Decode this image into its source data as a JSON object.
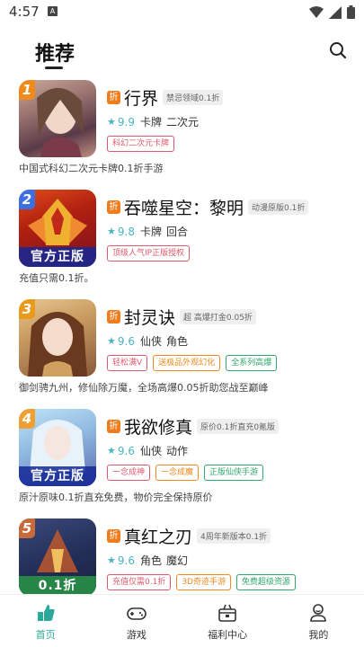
{
  "status": {
    "time": "4:57",
    "notif": "A"
  },
  "header": {
    "title": "推荐"
  },
  "games": [
    {
      "rank": "1",
      "rank_color": "#f08a1d",
      "name": "行界",
      "subtitle": "禁忌领域0.1折",
      "score": "9.9",
      "genres": [
        "卡牌",
        "二次元"
      ],
      "tags": [
        {
          "text": "科幻二次元卡牌",
          "color": "#e05a6d"
        }
      ],
      "desc": "中国式科幻二次元卡牌0.1折手游",
      "banner": ""
    },
    {
      "rank": "2",
      "rank_color": "#3e6fe0",
      "name": "吞噬星空：黎明",
      "subtitle": "动漫原版0.1折",
      "score": "9.8",
      "genres": [
        "卡牌",
        "回合"
      ],
      "tags": [
        {
          "text": "顶级人气IP正版授权",
          "color": "#e05a6d"
        }
      ],
      "desc": "充值只需0.1折。",
      "banner": "官方正版"
    },
    {
      "rank": "3",
      "rank_color": "#e89a1d",
      "name": "封灵诀",
      "subtitle": "超 高爆打金0.05折",
      "score": "9.6",
      "genres": [
        "仙侠",
        "角色"
      ],
      "tags": [
        {
          "text": "轻松满V",
          "color": "#e05a6d"
        },
        {
          "text": "送极品外观幻化",
          "color": "#f08a1d"
        },
        {
          "text": "全系列高爆",
          "color": "#2faa6a"
        }
      ],
      "desc": "御剑骋九州，修仙除万魔，全场高爆0.05折助您战至巅峰",
      "banner": ""
    },
    {
      "rank": "4",
      "rank_color": "#f0a030",
      "name": "我欲修真",
      "subtitle": "原价0.1折直充0氪版",
      "score": "9.6",
      "genres": [
        "仙侠",
        "动作"
      ],
      "tags": [
        {
          "text": "一念成神",
          "color": "#e05a6d"
        },
        {
          "text": "一念成魔",
          "color": "#f08a1d"
        },
        {
          "text": "正版仙侠手游",
          "color": "#2faa6a"
        }
      ],
      "desc": "原汁原味0.1折直充免费，物价完全保持原价",
      "banner": "官方正版"
    },
    {
      "rank": "5",
      "rank_color": "#c86a3a",
      "name": "真红之刃",
      "subtitle": "4周年新版本0.1折",
      "score": "9.6",
      "genres": [
        "角色",
        "魔幻"
      ],
      "tags": [
        {
          "text": "充值仅需0.1折",
          "color": "#e05a6d"
        },
        {
          "text": "3D奇迹手游",
          "color": "#f08a1d"
        },
        {
          "text": "免费超级资源",
          "color": "#2faa6a"
        }
      ],
      "desc": "",
      "banner": "0.1折"
    }
  ],
  "disc_label": "折",
  "tabs": [
    {
      "label": "首页",
      "icon": "home-icon"
    },
    {
      "label": "游戏",
      "icon": "gamepad-icon"
    },
    {
      "label": "福利中心",
      "icon": "gift-icon"
    },
    {
      "label": "我的",
      "icon": "profile-icon"
    }
  ],
  "colors": {
    "accent": "#2aa899",
    "badge": "#f07d1d",
    "score": "#4ab5c2"
  }
}
